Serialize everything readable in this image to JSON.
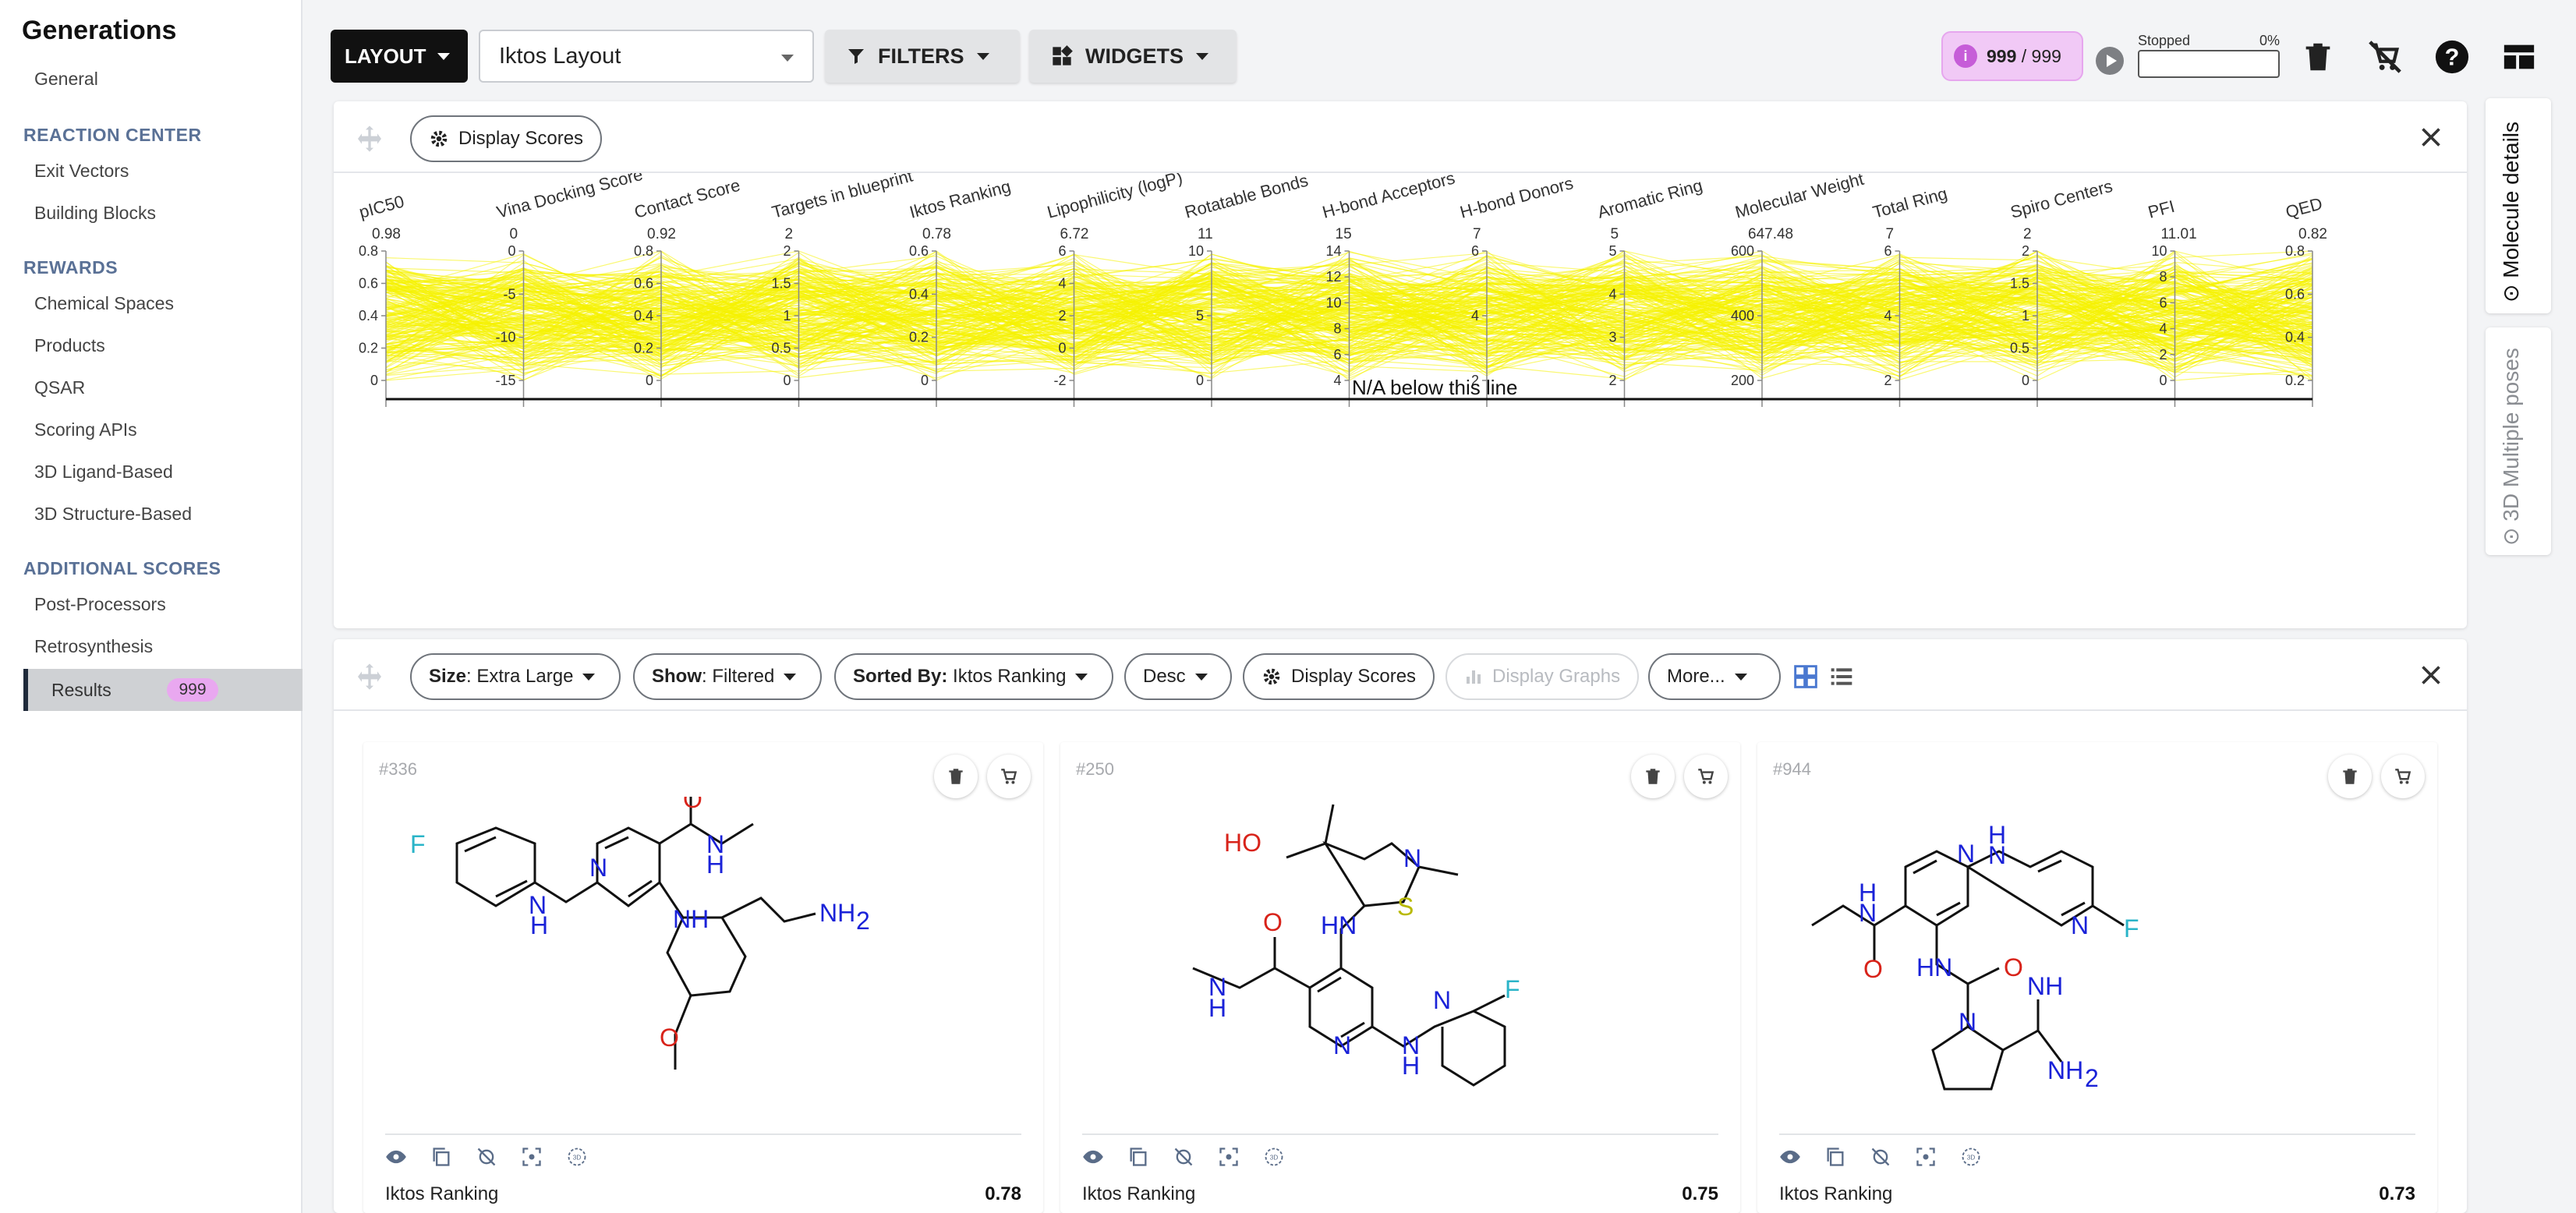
{
  "sidebar": {
    "title": "Generations",
    "general": "General",
    "sections": [
      {
        "header": "REACTION CENTER",
        "items": [
          "Exit Vectors",
          "Building Blocks"
        ]
      },
      {
        "header": "REWARDS",
        "items": [
          "Chemical Spaces",
          "Products",
          "QSAR",
          "Scoring APIs",
          "3D Ligand-Based",
          "3D Structure-Based"
        ]
      },
      {
        "header": "ADDITIONAL SCORES",
        "items": [
          "Post-Processors",
          "Retrosynthesis"
        ]
      }
    ],
    "active": {
      "label": "Results",
      "badge": "999"
    }
  },
  "toolbar": {
    "layout_label": "LAYOUT",
    "layout_value": "Iktos Layout",
    "filters_label": "FILTERS",
    "widgets_label": "WIDGETS",
    "counter": {
      "icon": "i",
      "current": "999",
      "total": "/ 999"
    },
    "progress": {
      "status": "Stopped",
      "percent_text": "0%",
      "fraction": 0
    },
    "icons": [
      "trash-icon",
      "cart-off-icon",
      "help-icon",
      "layout-icon"
    ]
  },
  "scores_panel": {
    "chip_label": "Display Scores",
    "na_label": "N/A below this line"
  },
  "chart_data": {
    "type": "parallel-coordinates",
    "line_color": "#f5f200",
    "axes": [
      {
        "name": "pIC50",
        "max_label": "0.98",
        "ticks": [
          "0",
          "0.2",
          "0.4",
          "0.6",
          "0.8"
        ]
      },
      {
        "name": "Vina Docking Score",
        "max_label": "0",
        "ticks": [
          "-15",
          "-10",
          "-5",
          "0"
        ]
      },
      {
        "name": "Contact Score",
        "max_label": "0.92",
        "ticks": [
          "0",
          "0.2",
          "0.4",
          "0.6",
          "0.8"
        ]
      },
      {
        "name": "Targets in blueprint",
        "max_label": "2",
        "ticks": [
          "0",
          "0.5",
          "1",
          "1.5",
          "2"
        ]
      },
      {
        "name": "Iktos Ranking",
        "max_label": "0.78",
        "ticks": [
          "0",
          "0.2",
          "0.4",
          "0.6"
        ]
      },
      {
        "name": "Lipophilicity (logP)",
        "max_label": "6.72",
        "ticks": [
          "-2",
          "0",
          "2",
          "4",
          "6"
        ]
      },
      {
        "name": "Rotatable Bonds",
        "max_label": "11",
        "ticks": [
          "0",
          "5",
          "10"
        ]
      },
      {
        "name": "H-bond Acceptors",
        "max_label": "15",
        "ticks": [
          "4",
          "6",
          "8",
          "10",
          "12",
          "14"
        ]
      },
      {
        "name": "H-bond Donors",
        "max_label": "7",
        "ticks": [
          "2",
          "4",
          "6"
        ]
      },
      {
        "name": "Aromatic Ring",
        "max_label": "5",
        "ticks": [
          "2",
          "3",
          "4",
          "5"
        ]
      },
      {
        "name": "Molecular Weight",
        "max_label": "647.48",
        "ticks": [
          "200",
          "400",
          "600"
        ]
      },
      {
        "name": "Total Ring",
        "max_label": "7",
        "ticks": [
          "2",
          "4",
          "6"
        ]
      },
      {
        "name": "Spiro Centers",
        "max_label": "2",
        "ticks": [
          "0",
          "0.5",
          "1",
          "1.5",
          "2"
        ]
      },
      {
        "name": "PFI",
        "max_label": "11.01",
        "ticks": [
          "0",
          "2",
          "4",
          "6",
          "8",
          "10"
        ]
      },
      {
        "name": "QED",
        "max_label": "0.82",
        "ticks": [
          "0.2",
          "0.4",
          "0.6",
          "0.8"
        ]
      }
    ]
  },
  "results_panel": {
    "size": {
      "key": "Size",
      "value": ": Extra Large"
    },
    "show": {
      "key": "Show",
      "value": ": Filtered"
    },
    "sorted": {
      "key": "Sorted By:",
      "value": " Iktos Ranking"
    },
    "order": "Desc",
    "display_scores": "Display Scores",
    "display_graphs": "Display Graphs",
    "more": "More..."
  },
  "cards": [
    {
      "id": "#336",
      "score_label": "Iktos Ranking",
      "score": "0.78"
    },
    {
      "id": "#250",
      "score_label": "Iktos Ranking",
      "score": "0.75"
    },
    {
      "id": "#944",
      "score_label": "Iktos Ranking",
      "score": "0.73"
    }
  ],
  "right_tabs": [
    "Molecule details",
    "3D Multiple poses"
  ]
}
